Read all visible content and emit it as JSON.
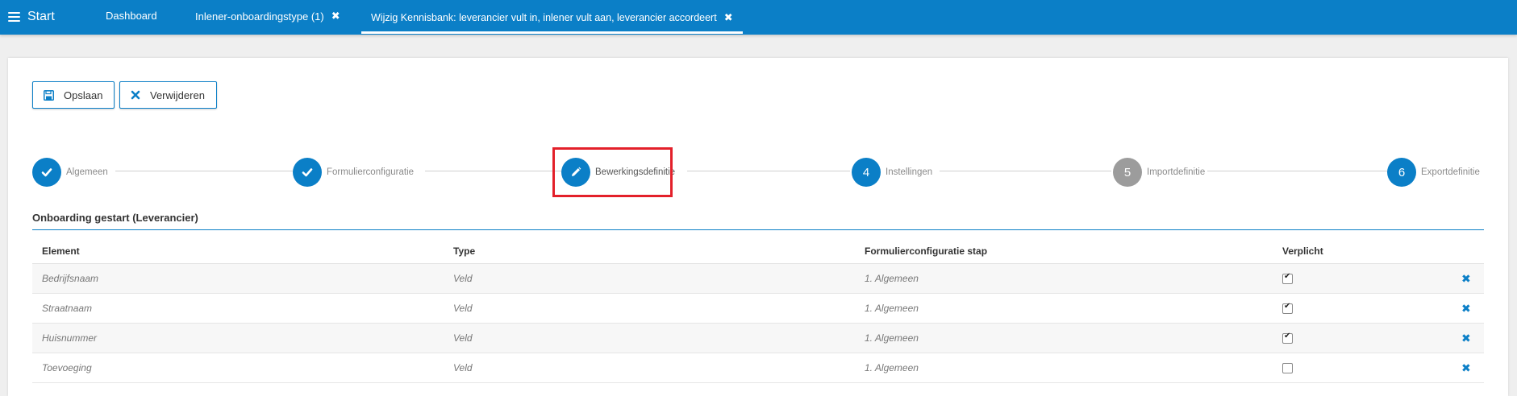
{
  "topbar": {
    "start_label": "Start",
    "tabs": [
      {
        "label": "Dashboard"
      },
      {
        "label": "Inlener-onboardingstype (1)"
      },
      {
        "label": "Wijzig Kennisbank: leverancier vult in, inlener vult aan, leverancier accordeert"
      }
    ],
    "close_glyph": "✖"
  },
  "toolbar": {
    "save_label": "Opslaan",
    "delete_label": "Verwijderen"
  },
  "steps": [
    {
      "label": "Algemeen",
      "marker": "",
      "status": "completed"
    },
    {
      "label": "Formulierconfiguratie",
      "marker": "",
      "status": "completed"
    },
    {
      "label": "Bewerkingsdefinitie",
      "marker": "",
      "status": "active"
    },
    {
      "label": "Instellingen",
      "marker": "4",
      "status": "pending"
    },
    {
      "label": "Importdefinitie",
      "marker": "5",
      "status": "disabled"
    },
    {
      "label": "Exportdefinitie",
      "marker": "6",
      "status": "pending"
    }
  ],
  "section": {
    "title": "Onboarding gestart (Leverancier)"
  },
  "table": {
    "columns": [
      "Element",
      "Type",
      "Formulierconfiguratie stap",
      "Verplicht"
    ],
    "rows": [
      {
        "element": "Bedrijfsnaam",
        "type": "Veld",
        "stap": "1. Algemeen",
        "verplicht": true
      },
      {
        "element": "Straatnaam",
        "type": "Veld",
        "stap": "1. Algemeen",
        "verplicht": true
      },
      {
        "element": "Huisnummer",
        "type": "Veld",
        "stap": "1. Algemeen",
        "verplicht": true
      },
      {
        "element": "Toevoeging",
        "type": "Veld",
        "stap": "1. Algemeen",
        "verplicht": false
      }
    ]
  },
  "colors": {
    "primary": "#0b7fc7",
    "highlight": "#e3202a",
    "disabled_step": "#9c9c9c"
  }
}
